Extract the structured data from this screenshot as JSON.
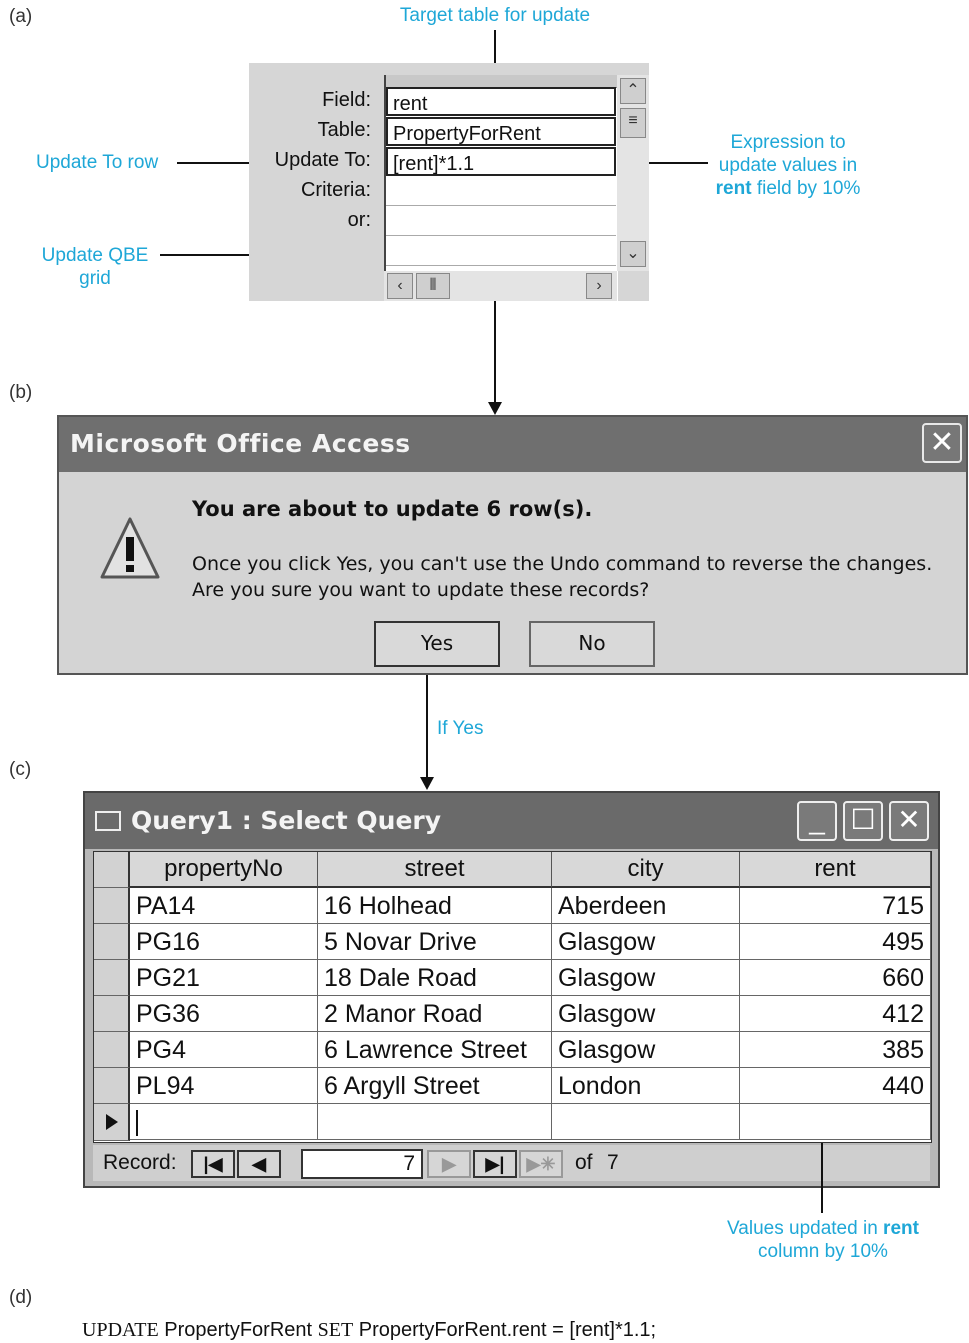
{
  "panels": {
    "a": "(a)",
    "b": "(b)",
    "c": "(c)",
    "d": "(d)"
  },
  "callouts": {
    "target_table": "Target table for update",
    "update_to_row": "Update To row",
    "update_qbe_grid_line1": "Update QBE",
    "update_qbe_grid_line2": "grid",
    "expression_line1": "Expression to",
    "expression_line2": "update values in",
    "expression_line3_bold": "rent",
    "expression_line3_rest": " field by 10%",
    "if_yes": "If Yes",
    "values_updated_line1_pre": "Values updated in ",
    "values_updated_line1_bold": "rent",
    "values_updated_line2": "column by 10%"
  },
  "qbe": {
    "labels": {
      "field": "Field:",
      "table": "Table:",
      "update_to": "Update To:",
      "criteria": "Criteria:",
      "or": "or:"
    },
    "values": {
      "field": "rent",
      "table": "PropertyForRent",
      "update_to": "[rent]*1.1",
      "criteria": "",
      "or": ""
    }
  },
  "dialog": {
    "title": "Microsoft Office Access",
    "close_glyph": "✕",
    "message_bold": "You are about to update 6 row(s).",
    "message_line1": "Once you click Yes, you can't use the Undo command to reverse the changes.",
    "message_line2": "Are you sure you want to update these records?",
    "yes_label": "Yes",
    "no_label": "No",
    "icon": "warning-icon"
  },
  "query_window": {
    "title": "Query1 : Select Query",
    "columns": [
      "propertyNo",
      "street",
      "city",
      "rent"
    ],
    "rows": [
      [
        "PA14",
        "16 Holhead",
        "Aberdeen",
        "715"
      ],
      [
        "PG16",
        "5 Novar Drive",
        "Glasgow",
        "495"
      ],
      [
        "PG21",
        "18 Dale Road",
        "Glasgow",
        "660"
      ],
      [
        "PG36",
        "2 Manor Road",
        "Glasgow",
        "412"
      ],
      [
        "PG4",
        "6 Lawrence Street",
        "Glasgow",
        "385"
      ],
      [
        "PL94",
        "6 Argyll Street",
        "London",
        "440"
      ]
    ],
    "record_label": "Record:",
    "record_current": "7",
    "record_of": "of",
    "record_total": "7"
  },
  "sql": {
    "kw_update": "UPDATE",
    "table": " PropertyForRent ",
    "kw_set": "SET",
    "assignment": " PropertyForRent.rent = [rent]*1.1;"
  },
  "colors": {
    "accent": "#1ea7d7",
    "titlebar": "#6f6f6f",
    "dialog_bg": "#d4d4d4"
  }
}
